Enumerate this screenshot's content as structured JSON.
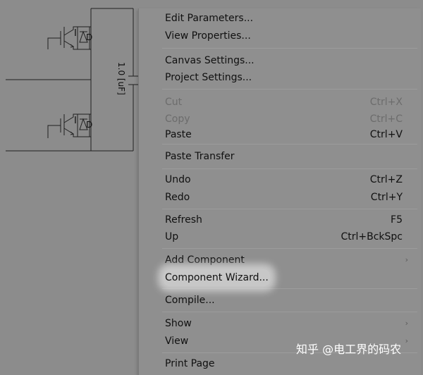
{
  "canvas": {
    "capacitor_label": "1.0 [uF]",
    "switch_top": {
      "gate_label": "I",
      "diode_label": "D"
    },
    "switch_bottom": {
      "gate_label": "I",
      "diode_label": "D"
    }
  },
  "context_menu": {
    "items": [
      {
        "label": "Edit Parameters...",
        "shortcut": ""
      },
      {
        "label": "View Properties...",
        "shortcut": ""
      },
      {
        "label": "Canvas Settings...",
        "shortcut": ""
      },
      {
        "label": "Project Settings...",
        "shortcut": ""
      },
      {
        "label": "Cut",
        "shortcut": "Ctrl+X",
        "disabled": true
      },
      {
        "label": "Copy",
        "shortcut": "Ctrl+C",
        "disabled": true
      },
      {
        "label": "Paste",
        "shortcut": "Ctrl+V"
      },
      {
        "label": "Paste Transfer",
        "shortcut": ""
      },
      {
        "label": "Undo",
        "shortcut": "Ctrl+Z"
      },
      {
        "label": "Redo",
        "shortcut": "Ctrl+Y"
      },
      {
        "label": "Refresh",
        "shortcut": "F5"
      },
      {
        "label": "Up",
        "shortcut": "Ctrl+BckSpc"
      },
      {
        "label": "Add Component",
        "shortcut": "",
        "submenu": true,
        "arrow": "›"
      },
      {
        "label": "Component Wizard...",
        "shortcut": "",
        "highlighted": true
      },
      {
        "label": "Compile...",
        "shortcut": ""
      },
      {
        "label": "Show",
        "shortcut": "",
        "submenu": true,
        "arrow": "›"
      },
      {
        "label": "View",
        "shortcut": "",
        "submenu": true,
        "arrow": "›"
      },
      {
        "label": "Print Page",
        "shortcut": ""
      }
    ]
  },
  "watermark": "知乎 @电工界的码农",
  "colors": {
    "background": "#8c8c8c",
    "menu_bg": "#8f8f8f",
    "wire": "#202020",
    "highlight": "#ffffff"
  }
}
